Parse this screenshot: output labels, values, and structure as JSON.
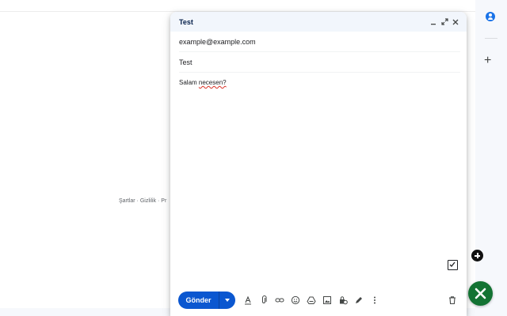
{
  "footer": {
    "links": "Şartlar · Gizlilik · Pr"
  },
  "compose": {
    "title": "Test",
    "header_icons": [
      "minimize-icon",
      "expand-icon",
      "close-icon"
    ],
    "to_value": "example@example.com",
    "subject_value": "Test",
    "body_prefix": "Salam ",
    "body_misspelled": "necesen?",
    "send_label": "Gönder",
    "toolbar_icons": [
      "text-format-icon",
      "attach-icon",
      "link-icon",
      "emoji-icon",
      "drive-icon",
      "photo-icon",
      "confidential-icon",
      "signature-icon",
      "more-options-icon",
      "trash-icon"
    ]
  },
  "side_panel": {
    "icons": [
      "account-icon",
      "add-icon"
    ]
  },
  "colors": {
    "send_button": "#0b57d0",
    "header_bg": "#f2f6fc",
    "fab_green": "#137333",
    "avatar_blue": "#1a73e8"
  }
}
